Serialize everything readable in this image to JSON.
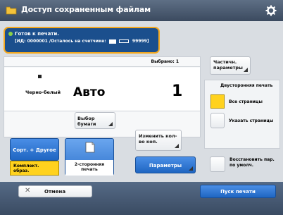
{
  "header": {
    "title": "Доступ сохраненным файлам",
    "settings_icon": "gear-icon",
    "app_icon": "folder-icon"
  },
  "status": {
    "line1": "Готов к печати.",
    "line2": "[ИД: 0000001 /Осталось на счетчике:",
    "toner_label": "",
    "counter": "99999]"
  },
  "main": {
    "selected_label": "Выбрано: 1",
    "color_mode": "Черно-белый",
    "paper": "Авто",
    "copies": "1",
    "paper_select_button": "Выбор бумаги"
  },
  "right_panel": {
    "partial_settings_button": "Частичн. параметры",
    "duplex_title": "Двусторонняя печать",
    "all_pages_label": "Все страницы",
    "specify_pages_label": "Указать страницы",
    "restore_button": "Восстановить пар. по умолч."
  },
  "lower_options": {
    "sort_button": "Сорт. + Другое",
    "sort_sub_button": "Комплект. образ.",
    "duplex_button": "2-сторонняя печать",
    "change_qty_button": "Изменить кол-во коп.",
    "params_button": "Параметры"
  },
  "footer": {
    "cancel_label": "Отмена",
    "print_label": "Пуск печати"
  },
  "colors": {
    "accent_orange": "#f4a81e",
    "status_blue": "#1b4f8d",
    "button_blue": "#1f66c2",
    "yellow": "#ffd21e"
  }
}
